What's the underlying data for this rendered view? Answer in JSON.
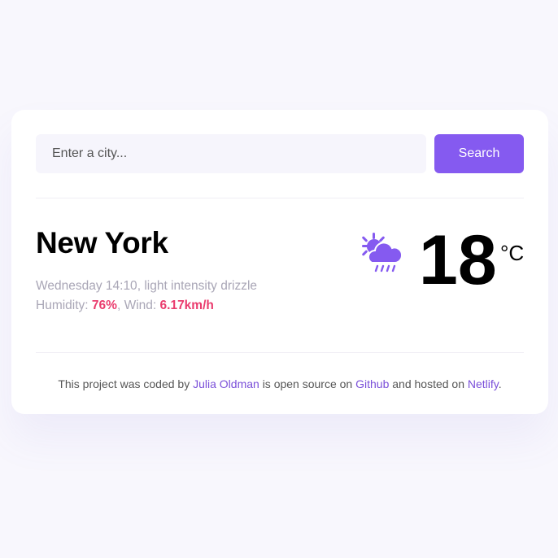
{
  "search": {
    "placeholder": "Enter a city...",
    "button_label": "Search"
  },
  "weather": {
    "city": "New York",
    "day": "Wednesday",
    "time": "14:10",
    "description": "light intensity drizzle",
    "humidity_label": "Humidity:",
    "humidity": "76%",
    "wind_label": "Wind:",
    "wind": "6.17km/h",
    "temperature": "18",
    "unit": "°C",
    "icon": "sun-cloud-rain-icon"
  },
  "footer": {
    "text_1": "This project was coded by",
    "author": "Julia Oldman",
    "text_2": "is open source on",
    "github": "Github",
    "text_3": "and hosted on",
    "netlify": "Netlify",
    "text_4": "."
  },
  "colors": {
    "accent": "#855af0",
    "highlight": "#ea3c6e",
    "link": "#7a4fd9",
    "background": "#f8f7fd"
  }
}
